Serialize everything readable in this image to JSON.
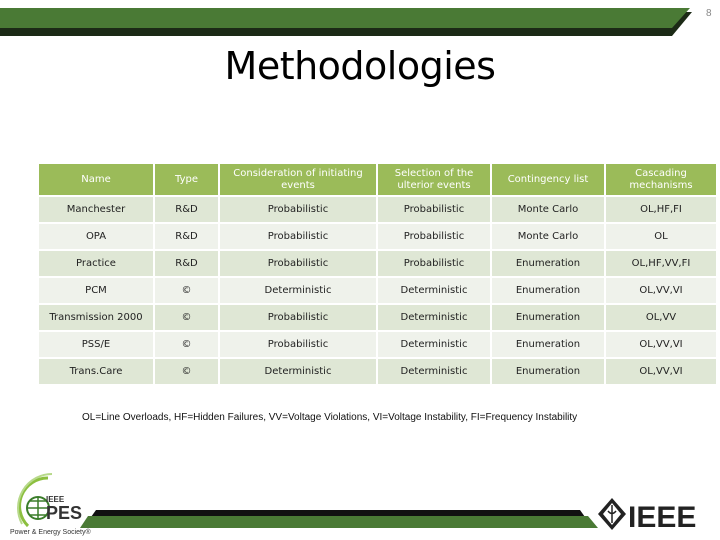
{
  "page_number": "8",
  "title": "Methodologies",
  "table": {
    "headers": [
      "Name",
      "Type",
      "Consideration of initiating events",
      "Selection of the ulterior events",
      "Contingency list",
      "Cascading mechanisms"
    ],
    "rows": [
      [
        "Manchester",
        "R&D",
        "Probabilistic",
        "Probabilistic",
        "Monte Carlo",
        "OL,HF,FI"
      ],
      [
        "OPA",
        "R&D",
        "Probabilistic",
        "Probabilistic",
        "Monte Carlo",
        "OL"
      ],
      [
        "Practice",
        "R&D",
        "Probabilistic",
        "Probabilistic",
        "Enumeration",
        "OL,HF,VV,FI"
      ],
      [
        "PCM",
        "©",
        "Deterministic",
        "Deterministic",
        "Enumeration",
        "OL,VV,VI"
      ],
      [
        "Transmission 2000",
        "©",
        "Probabilistic",
        "Deterministic",
        "Enumeration",
        "OL,VV"
      ],
      [
        "PSS/E",
        "©",
        "Probabilistic",
        "Deterministic",
        "Enumeration",
        "OL,VV,VI"
      ],
      [
        "Trans.Care",
        "©",
        "Deterministic",
        "Deterministic",
        "Enumeration",
        "OL,VV,VI"
      ]
    ]
  },
  "legend": "OL=Line Overloads, HF=Hidden Failures, VV=Voltage Violations, VI=Voltage Instability, FI=Frequency Instability",
  "logos": {
    "left": "IEEE PES Power & Energy Society®",
    "right": "IEEE"
  },
  "colors": {
    "bar_green": "#4a7a35",
    "header_green": "#9bbb59",
    "row_odd": "#dfe7d5",
    "row_even": "#eff2eb"
  }
}
